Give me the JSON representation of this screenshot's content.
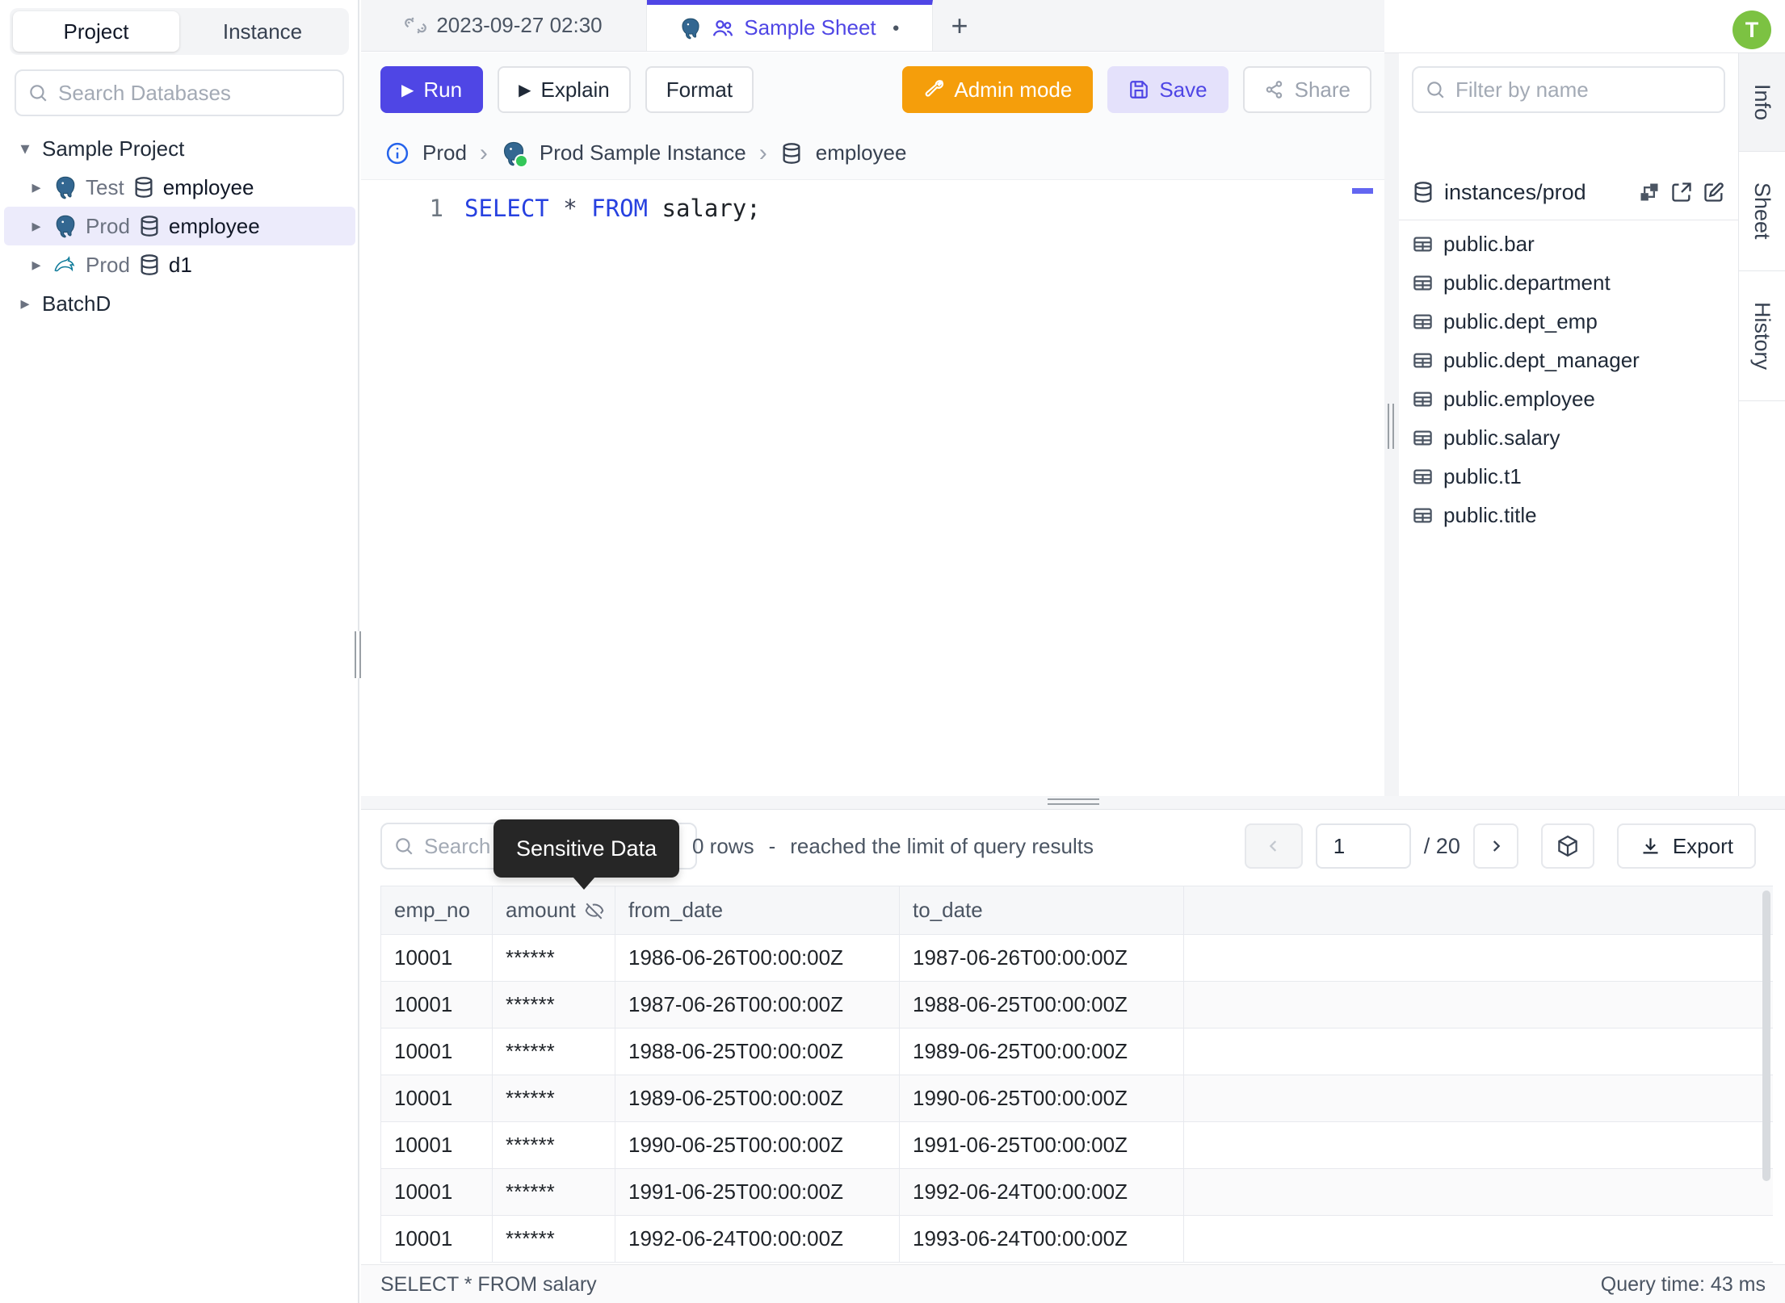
{
  "window": {
    "avatar_initial": "T"
  },
  "colors": {
    "accent_indigo": "#4F46E5",
    "admin_orange": "#F59E0B",
    "avatar_green": "#7CC242",
    "keyword_blue": "#2741E0",
    "tooltip_bg": "#262626",
    "status_green": "#34C759"
  },
  "left_panel": {
    "tabs": [
      {
        "label": "Project",
        "active": true
      },
      {
        "label": "Instance",
        "active": false
      }
    ],
    "search": {
      "placeholder": "Search Databases"
    },
    "tree": [
      {
        "kind": "project",
        "label": "Sample Project",
        "expanded": true
      },
      {
        "kind": "database",
        "env": "Test",
        "name": "employee",
        "engine": "postgresql",
        "selected": false
      },
      {
        "kind": "database",
        "env": "Prod",
        "name": "employee",
        "engine": "postgresql",
        "selected": true
      },
      {
        "kind": "database",
        "env": "Prod",
        "name": "d1",
        "engine": "mysql",
        "selected": false
      },
      {
        "kind": "project",
        "label": "BatchD",
        "expanded": false
      }
    ]
  },
  "editor_tabs": {
    "tabs": [
      {
        "label": "2023-09-27 02:30",
        "icon": "unlink-icon",
        "active": false,
        "dirty": false
      },
      {
        "label": "Sample Sheet",
        "icon": "postgresql-users",
        "active": true,
        "dirty": true
      }
    ],
    "add_label": "+"
  },
  "toolbar": {
    "run_label": "Run",
    "explain_label": "Explain",
    "format_label": "Format",
    "admin_mode_label": "Admin mode",
    "save_label": "Save",
    "share_label": "Share"
  },
  "breadcrumb": {
    "environment": "Prod",
    "instance": "Prod Sample Instance",
    "database": "employee"
  },
  "editor": {
    "line_number": "1",
    "sql": {
      "kw_select": "SELECT",
      "star": "*",
      "kw_from": "FROM",
      "identifier": "salary;"
    }
  },
  "schema_panel": {
    "filter": {
      "placeholder": "Filter by name"
    },
    "path": "instances/prod",
    "tables": [
      "public.bar",
      "public.department",
      "public.dept_emp",
      "public.dept_manager",
      "public.employee",
      "public.salary",
      "public.t1",
      "public.title"
    ]
  },
  "side_tabs": [
    {
      "label": "Info",
      "active": true
    },
    {
      "label": "Sheet",
      "active": false
    },
    {
      "label": "History",
      "active": false
    }
  ],
  "results": {
    "search": {
      "placeholder": "Search"
    },
    "tooltip": "Sensitive Data",
    "row_count_text": "0 rows",
    "separator": "-",
    "limit_text": "reached the limit of query results",
    "pagination": {
      "page": "1",
      "total": "/ 20"
    },
    "export_label": "Export",
    "table": {
      "columns": [
        {
          "name": "emp_no",
          "masked": false
        },
        {
          "name": "amount",
          "masked": true
        },
        {
          "name": "from_date",
          "masked": false
        },
        {
          "name": "to_date",
          "masked": false
        }
      ],
      "rows": [
        [
          "10001",
          "******",
          "1986-06-26T00:00:00Z",
          "1987-06-26T00:00:00Z"
        ],
        [
          "10001",
          "******",
          "1987-06-26T00:00:00Z",
          "1988-06-25T00:00:00Z"
        ],
        [
          "10001",
          "******",
          "1988-06-25T00:00:00Z",
          "1989-06-25T00:00:00Z"
        ],
        [
          "10001",
          "******",
          "1989-06-25T00:00:00Z",
          "1990-06-25T00:00:00Z"
        ],
        [
          "10001",
          "******",
          "1990-06-25T00:00:00Z",
          "1991-06-25T00:00:00Z"
        ],
        [
          "10001",
          "******",
          "1991-06-25T00:00:00Z",
          "1992-06-24T00:00:00Z"
        ],
        [
          "10001",
          "******",
          "1992-06-24T00:00:00Z",
          "1993-06-24T00:00:00Z"
        ]
      ]
    },
    "statement": "SELECT * FROM salary",
    "query_time": "Query time: 43 ms"
  }
}
